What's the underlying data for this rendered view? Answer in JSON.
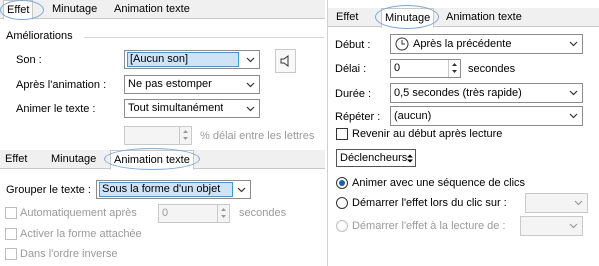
{
  "effect_panel": {
    "tabs": [
      "Effet",
      "Minutage",
      "Animation texte"
    ],
    "section_title": "Améliorations",
    "son": {
      "label": "Son :",
      "value": "[Aucun son]"
    },
    "apres_animation": {
      "label": "Après l'animation :",
      "value": "Ne pas estomper"
    },
    "animer_texte": {
      "label": "Animer le texte :",
      "value": "Tout simultanément"
    },
    "delai_lettres": {
      "value": "",
      "suffix": "% délai entre les lettres"
    }
  },
  "text_anim_panel": {
    "tabs": [
      "Effet",
      "Minutage",
      "Animation texte"
    ],
    "grouper": {
      "label": "Grouper le texte :",
      "value": "Sous la forme d'un objet"
    },
    "auto_apres": {
      "label": "Automatiquement après",
      "value": "0",
      "suffix": "secondes"
    },
    "forme_attachee": "Activer la forme attachée",
    "ordre_inverse": "Dans l'ordre inverse"
  },
  "timing_panel": {
    "tabs": [
      "Effet",
      "Minutage",
      "Animation texte"
    ],
    "debut": {
      "label": "Début :",
      "value": "Après la précédente"
    },
    "delai": {
      "label": "Délai :",
      "value": "0",
      "suffix": "secondes"
    },
    "duree": {
      "label": "Durée :",
      "value": "0,5 secondes (très rapide)"
    },
    "repeter": {
      "label": "Répéter :",
      "value": "(aucun)"
    },
    "revenir": "Revenir au début après lecture",
    "declencheurs": "Déclencheurs",
    "radio1": "Animer avec une séquence de clics",
    "radio2": "Démarrer l'effet lors du clic sur :",
    "radio3": "Démarrer l'effet à la lecture de :"
  }
}
